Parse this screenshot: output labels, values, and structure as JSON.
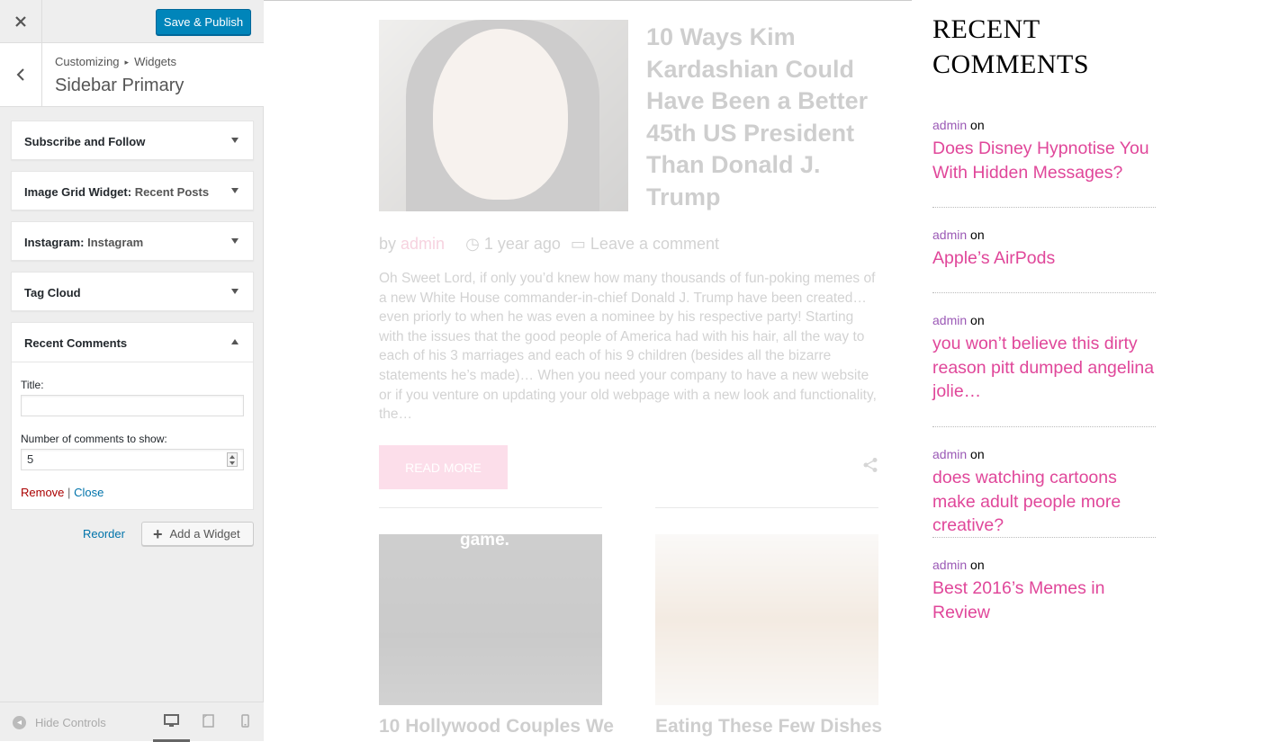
{
  "customizer": {
    "close_icon": "close-icon",
    "publish_label": "Save & Publish",
    "breadcrumb": {
      "parent": "Customizing",
      "child": "Widgets"
    },
    "section_title": "Sidebar Primary",
    "widgets": [
      {
        "title": "Subscribe and Follow",
        "instance": ""
      },
      {
        "title": "Image Grid Widget:",
        "instance": "Recent Posts"
      },
      {
        "title": "Instagram:",
        "instance": "Instagram"
      },
      {
        "title": "Tag Cloud",
        "instance": ""
      }
    ],
    "expanded_widget": {
      "title": "Recent Comments",
      "title_label": "Title:",
      "title_value": "",
      "count_label": "Number of comments to show:",
      "count_value": "5",
      "remove_label": "Remove",
      "divider": "|",
      "close_label": "Close"
    },
    "reorder_label": "Reorder",
    "add_widget_label": "Add a Widget",
    "hide_controls_label": "Hide Controls",
    "devices": [
      "desktop",
      "tablet",
      "mobile"
    ],
    "active_device": "desktop"
  },
  "preview": {
    "featured": {
      "title": "10 Ways Kim Kardashian Could Have Been a Better 45th US President Than Donald J. Trump",
      "by": "by",
      "author": "admin",
      "time": "1 year ago",
      "comments": "Leave a comment",
      "excerpt": "Oh Sweet Lord, if only you’d knew how many thousands of fun-poking memes of a new White House commander-in-chief Donald J. Trump have been created… even priorly to when he was even a nominee by his respective party! Starting with the issues that the good people of America had with his hair, all the way to each of his 3 marriages and each of his 9 children (besides all the bizarre statements he’s made)… When you need your company to have a new website or if you venture on updating your old webpage with a new look and functionality, the…",
      "read_more": "READ MORE"
    },
    "grid_image_caption": "game.",
    "grid_titles": [
      "10 Hollywood Couples We",
      "Eating These Few Dishes"
    ],
    "recent_comments": {
      "heading_line1": "RECENT",
      "heading_line2": "COMMENTS",
      "on_word": "on",
      "items": [
        {
          "author": "admin",
          "post": "Does Disney Hypnotise You With Hidden Messages?"
        },
        {
          "author": "admin",
          "post": "Apple’s AirPods"
        },
        {
          "author": "admin",
          "post": "you won’t believe this dirty reason pitt dumped angelina jolie…"
        },
        {
          "author": "admin",
          "post": "does watching cartoons make adult people more creative?"
        },
        {
          "author": "admin",
          "post": "Best 2016’s Memes in Review"
        }
      ]
    }
  },
  "colors": {
    "primary": "#0085ba",
    "link": "#0073aa",
    "remove": "#aa0000",
    "accent_pink": "#e0479a",
    "author_purple": "#9b59b6"
  }
}
